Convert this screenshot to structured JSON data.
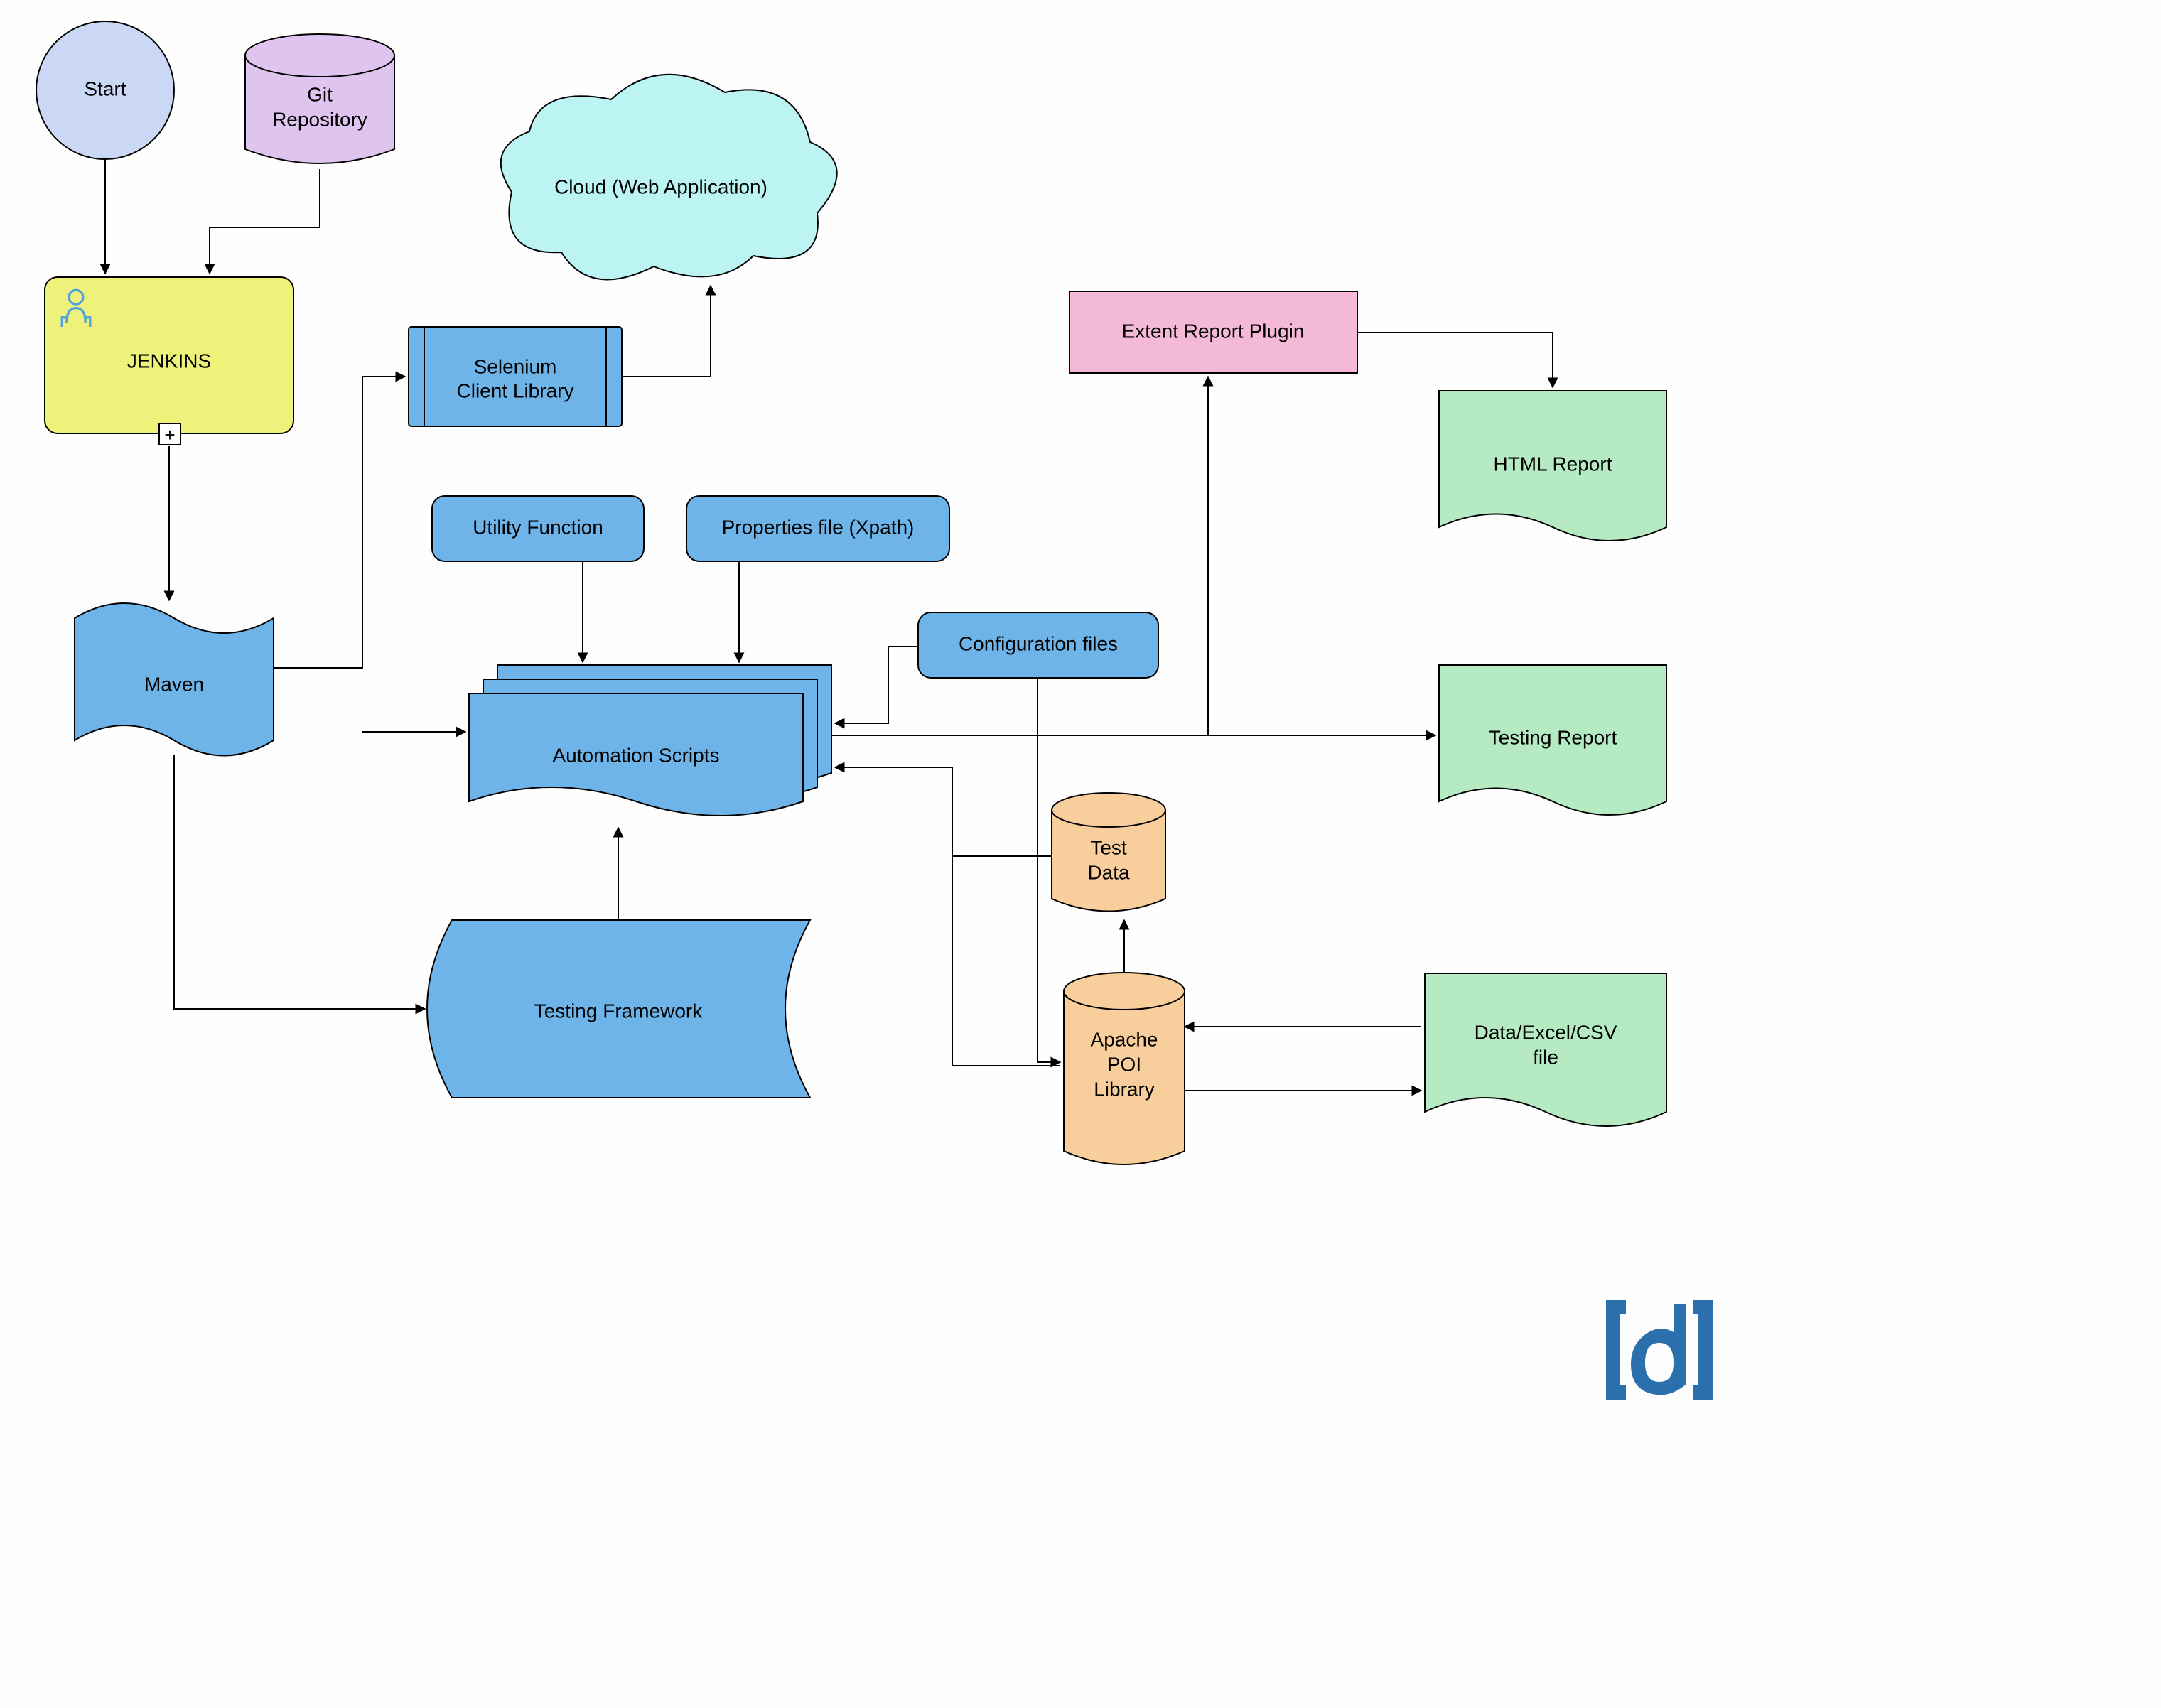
{
  "diagram": {
    "nodes": {
      "start": "Start",
      "git1": "Git",
      "git2": "Repository",
      "jenkins": "JENKINS",
      "cloud": "Cloud (Web Application)",
      "selenium1": "Selenium",
      "selenium2": "Client Library",
      "extent": "Extent Report Plugin",
      "html": "HTML Report",
      "utility": "Utility Function",
      "properties": "Properties file (Xpath)",
      "config": "Configuration files",
      "maven": "Maven",
      "automation": "Automation Scripts",
      "testingReport": "Testing Report",
      "testData1": "Test",
      "testData2": "Data",
      "testingFramework": "Testing Framework",
      "apache1": "Apache",
      "apache2": "POI",
      "apache3": "Library",
      "data1": "Data/Excel/CSV",
      "data2": "file"
    },
    "colors": {
      "start": "#cad8f5",
      "git": "#e0c4f0",
      "jenkins": "#eff27a",
      "cloud": "#bcf3f3",
      "blue": "#6fb4e8",
      "pink": "#f3b9d7",
      "green": "#b5eac2",
      "orange": "#f7ce9c",
      "stroke": "#000000",
      "jenkinsIcon": "#50a2e2",
      "logo": "#2b70ac"
    }
  }
}
